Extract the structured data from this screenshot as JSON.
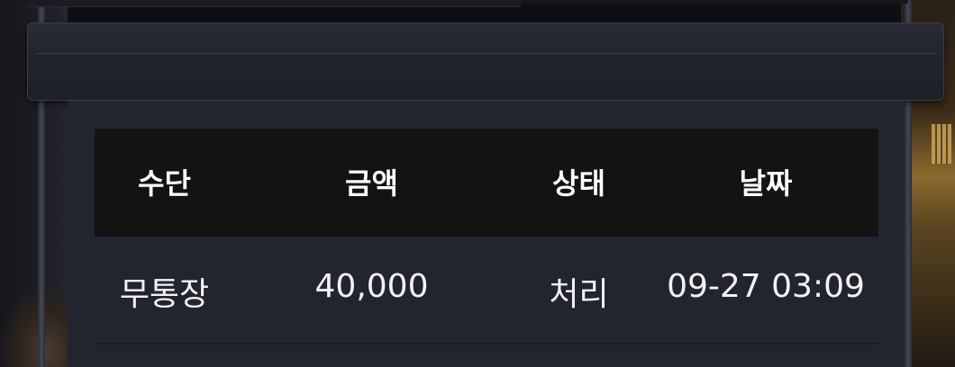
{
  "table": {
    "headers": [
      "수단",
      "금액",
      "상태",
      "날짜"
    ],
    "rows": [
      {
        "method": "무통장",
        "amount": "40,000",
        "status": "처리",
        "date": "09-27 03:09"
      }
    ]
  }
}
